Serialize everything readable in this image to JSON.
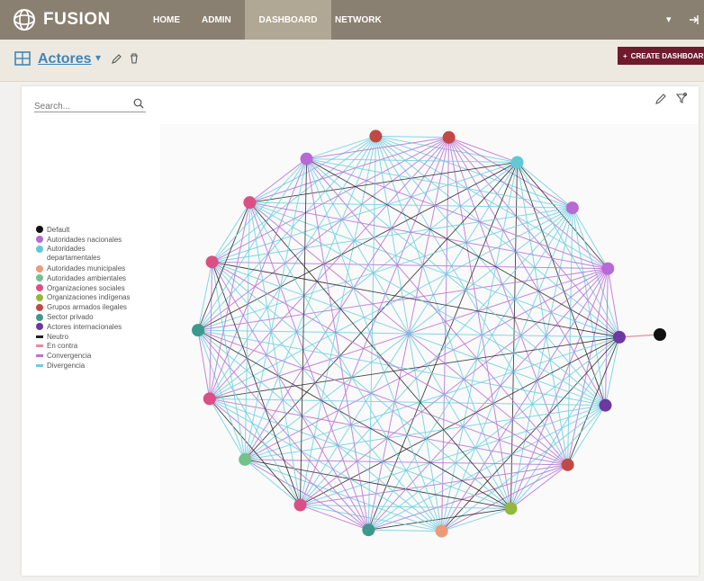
{
  "app": {
    "name": "FUSION",
    "logo_icon": "fusion-logo-icon"
  },
  "nav": {
    "items": [
      {
        "label": "HOME",
        "active": false
      },
      {
        "label": "ADMIN",
        "active": false
      },
      {
        "label": "DASHBOARD",
        "active": true
      },
      {
        "label": "NETWORK",
        "active": false
      }
    ],
    "right_icons": [
      "chevron-down-icon",
      "logout-icon"
    ]
  },
  "dashboard": {
    "title": "Actores",
    "title_icon": "dashboard-grid-icon",
    "create_button": "CREATE DASHBOARD"
  },
  "search": {
    "placeholder": "Search..."
  },
  "legend": {
    "nodes": [
      {
        "label": "Default",
        "color": "#111111"
      },
      {
        "label": "Autoridades nacionales",
        "color": "#b66ad3"
      },
      {
        "label": "Autoridades departamentales",
        "color": "#62c8d8"
      },
      {
        "label": "Autoridades municipales",
        "color": "#ec9a78"
      },
      {
        "label": "Autoridades ambientales",
        "color": "#72c28a"
      },
      {
        "label": "Organizaciones sociales",
        "color": "#db4f84"
      },
      {
        "label": "Organizaciones indígenas",
        "color": "#93b83c"
      },
      {
        "label": "Grupos armados ilegales",
        "color": "#bf4a45"
      },
      {
        "label": "Sector privado",
        "color": "#3b9a8d"
      },
      {
        "label": "Actores internacionales",
        "color": "#6d38a1"
      }
    ],
    "edges": [
      {
        "label": "Neutro",
        "color": "#222222"
      },
      {
        "label": "En contra",
        "color": "#e88aa1"
      },
      {
        "label": "Convergencia",
        "color": "#b972d4"
      },
      {
        "label": "Divergencia",
        "color": "#6dcfe0"
      }
    ]
  },
  "network": {
    "nodes": [
      {
        "type": "Grupos armados ilegales"
      },
      {
        "type": "Grupos armados ilegales"
      },
      {
        "type": "Autoridades departamentales"
      },
      {
        "type": "Autoridades nacionales"
      },
      {
        "type": "Autoridades nacionales"
      },
      {
        "type": "Actores internacionales"
      },
      {
        "type": "Actores internacionales"
      },
      {
        "type": "Grupos armados ilegales"
      },
      {
        "type": "Organizaciones indígenas"
      },
      {
        "type": "Autoridades municipales"
      },
      {
        "type": "Sector privado"
      },
      {
        "type": "Organizaciones sociales"
      },
      {
        "type": "Autoridades ambientales"
      },
      {
        "type": "Organizaciones sociales"
      },
      {
        "type": "Sector privado"
      },
      {
        "type": "Organizaciones sociales"
      },
      {
        "type": "Organizaciones sociales"
      },
      {
        "type": "Autoridades nacionales"
      }
    ],
    "isolated_node": {
      "type": "Default"
    }
  }
}
